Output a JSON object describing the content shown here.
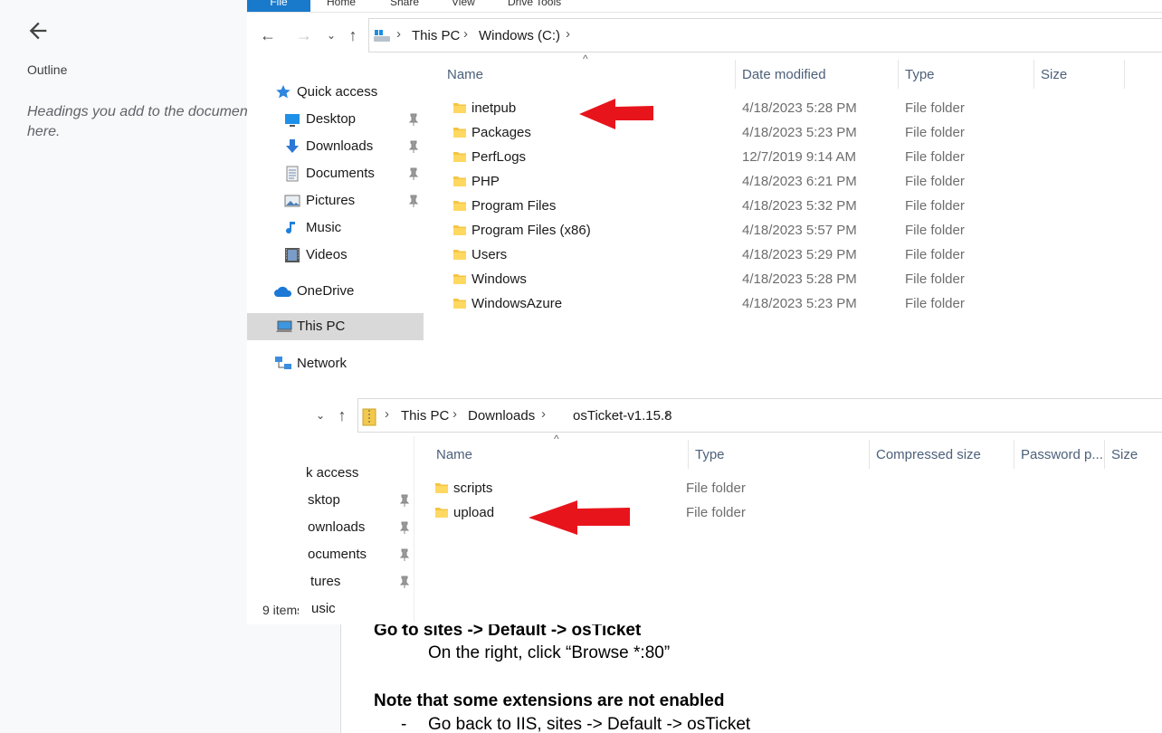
{
  "doc": {
    "outline_title": "Outline",
    "outline_hint": "Headings you add to the document will appear here.",
    "lines": {
      "sites": "Go to sites -> Default -> osTicket",
      "browse": "On the right, click “Browse *:80”",
      "note": "Note that some extensions are not enabled",
      "back": "Go back to IIS, sites -> Default -> osTicket",
      "dash": "-"
    }
  },
  "explorer1": {
    "ribbon": {
      "file": "File",
      "home": "Home",
      "share": "Share",
      "view": "View",
      "drive_tools": "Drive Tools"
    },
    "breadcrumb": [
      "This PC",
      "Windows (C:)"
    ],
    "nav": [
      {
        "label": "Quick access",
        "icon": "star-icon"
      },
      {
        "label": "Desktop",
        "icon": "desktop-icon",
        "pinned": true
      },
      {
        "label": "Downloads",
        "icon": "download-icon",
        "pinned": true
      },
      {
        "label": "Documents",
        "icon": "documents-icon",
        "pinned": true
      },
      {
        "label": "Pictures",
        "icon": "pictures-icon",
        "pinned": true
      },
      {
        "label": "Music",
        "icon": "music-icon"
      },
      {
        "label": "Videos",
        "icon": "videos-icon"
      },
      {
        "label": "OneDrive",
        "icon": "cloud-icon"
      },
      {
        "label": "This PC",
        "icon": "computer-icon",
        "selected": true
      },
      {
        "label": "Network",
        "icon": "network-icon"
      }
    ],
    "columns": {
      "name": "Name",
      "date": "Date modified",
      "type": "Type",
      "size": "Size"
    },
    "rows": [
      {
        "name": "inetpub",
        "date": "4/18/2023 5:28 PM",
        "type": "File folder"
      },
      {
        "name": "Packages",
        "date": "4/18/2023 5:23 PM",
        "type": "File folder"
      },
      {
        "name": "PerfLogs",
        "date": "12/7/2019 9:14 AM",
        "type": "File folder"
      },
      {
        "name": "PHP",
        "date": "4/18/2023 6:21 PM",
        "type": "File folder"
      },
      {
        "name": "Program Files",
        "date": "4/18/2023 5:32 PM",
        "type": "File folder"
      },
      {
        "name": "Program Files (x86)",
        "date": "4/18/2023 5:57 PM",
        "type": "File folder"
      },
      {
        "name": "Users",
        "date": "4/18/2023 5:29 PM",
        "type": "File folder"
      },
      {
        "name": "Windows",
        "date": "4/18/2023 5:28 PM",
        "type": "File folder"
      },
      {
        "name": "WindowsAzure",
        "date": "4/18/2023 5:23 PM",
        "type": "File folder"
      }
    ],
    "status": "9 items"
  },
  "explorer2": {
    "breadcrumb": [
      "This PC",
      "Downloads",
      "osTicket-v1.15.8"
    ],
    "nav": [
      {
        "label": "k access"
      },
      {
        "label": "sktop",
        "pinned": true
      },
      {
        "label": "ownloads",
        "pinned": true
      },
      {
        "label": "ocuments",
        "pinned": true
      },
      {
        "label": "tures",
        "pinned": true
      },
      {
        "label": "usic"
      }
    ],
    "columns": {
      "name": "Name",
      "type": "Type",
      "compressed": "Compressed size",
      "password": "Password p...",
      "size": "Size"
    },
    "rows": [
      {
        "name": "scripts",
        "type": "File folder"
      },
      {
        "name": "upload",
        "type": "File folder"
      }
    ]
  },
  "colors": {
    "arrow": "#e8141c",
    "folder": "#f5c542",
    "accent": "#1979ca",
    "selected": "#d9d9d9"
  }
}
